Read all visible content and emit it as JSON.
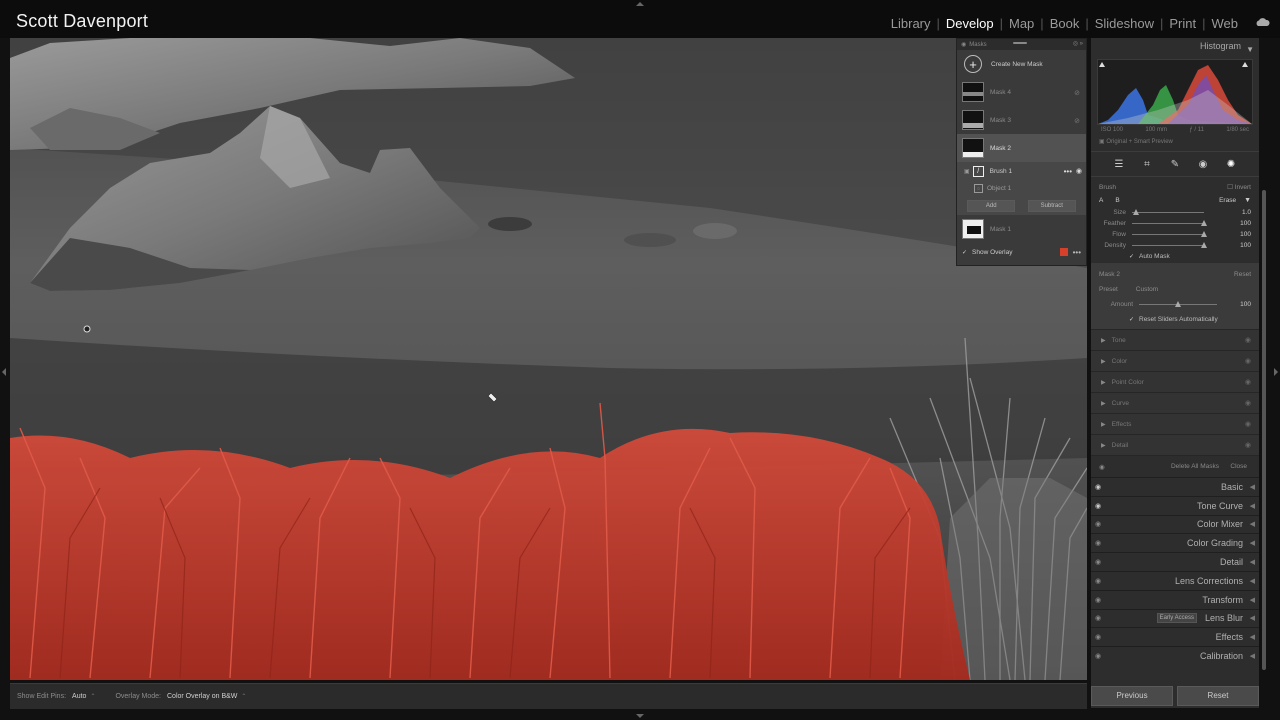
{
  "identity_plate": "Scott Davenport",
  "modules": [
    {
      "label": "Library",
      "active": false
    },
    {
      "label": "Develop",
      "active": true
    },
    {
      "label": "Map",
      "active": false
    },
    {
      "label": "Book",
      "active": false
    },
    {
      "label": "Slideshow",
      "active": false
    },
    {
      "label": "Print",
      "active": false
    },
    {
      "label": "Web",
      "active": false
    }
  ],
  "colors": {
    "mask_overlay": "#c8382a",
    "active_module": "#ffffff",
    "panel_bg": "#2d2d2d"
  },
  "toolbar": {
    "edit_pins_label": "Show Edit Pins:",
    "edit_pins_value": "Auto",
    "overlay_label": "Overlay Mode:",
    "overlay_value": "Color Overlay on B&W"
  },
  "masks_panel": {
    "title": "Masks",
    "create": "Create New Mask",
    "mask4": "Mask 4",
    "mask3": "Mask 3",
    "mask2": "Mask 2",
    "brush1": "Brush 1",
    "object1": "Object 1",
    "add": "Add",
    "subtract": "Subtract",
    "mask1": "Mask 1",
    "show_overlay": "Show Overlay"
  },
  "histogram": {
    "title": "Histogram",
    "iso": "ISO 100",
    "focal": "100 mm",
    "aperture": "ƒ / 11",
    "shutter": "1/80 sec",
    "preview": "Original + Smart Preview"
  },
  "brush": {
    "title": "Brush",
    "invert": "Invert",
    "a": "A",
    "b": "B",
    "erase": "Erase",
    "sliders": [
      {
        "label": "Size",
        "value": "1.0",
        "pos": 0.05
      },
      {
        "label": "Feather",
        "value": "100",
        "pos": 1.0
      },
      {
        "label": "Flow",
        "value": "100",
        "pos": 1.0
      },
      {
        "label": "Density",
        "value": "100",
        "pos": 1.0
      }
    ],
    "auto_mask": "Auto Mask"
  },
  "mask2_settings": {
    "title": "Mask 2",
    "reset": "Reset",
    "preset_label": "Preset",
    "preset_value": "Custom",
    "amount_label": "Amount",
    "amount_value": "100",
    "amount_pos": 0.5,
    "reset_sliders": "Reset Sliders Automatically"
  },
  "mask_subpanels": [
    "Tone",
    "Color",
    "Point Color",
    "Curve",
    "Effects",
    "Detail"
  ],
  "delete_all": "Delete All Masks",
  "close": "Close",
  "sections": [
    {
      "label": "Basic",
      "eye": "on"
    },
    {
      "label": "Tone Curve",
      "eye": "on"
    },
    {
      "label": "Color Mixer",
      "eye": "off"
    },
    {
      "label": "Color Grading",
      "eye": "off"
    },
    {
      "label": "Detail",
      "eye": "off"
    },
    {
      "label": "Lens Corrections",
      "eye": "off"
    },
    {
      "label": "Transform",
      "eye": "off"
    },
    {
      "label": "Lens Blur",
      "eye": "off",
      "badge": "Early Access"
    },
    {
      "label": "Effects",
      "eye": "off"
    },
    {
      "label": "Calibration",
      "eye": "off"
    }
  ],
  "buttons": {
    "previous": "Previous",
    "reset": "Reset"
  }
}
